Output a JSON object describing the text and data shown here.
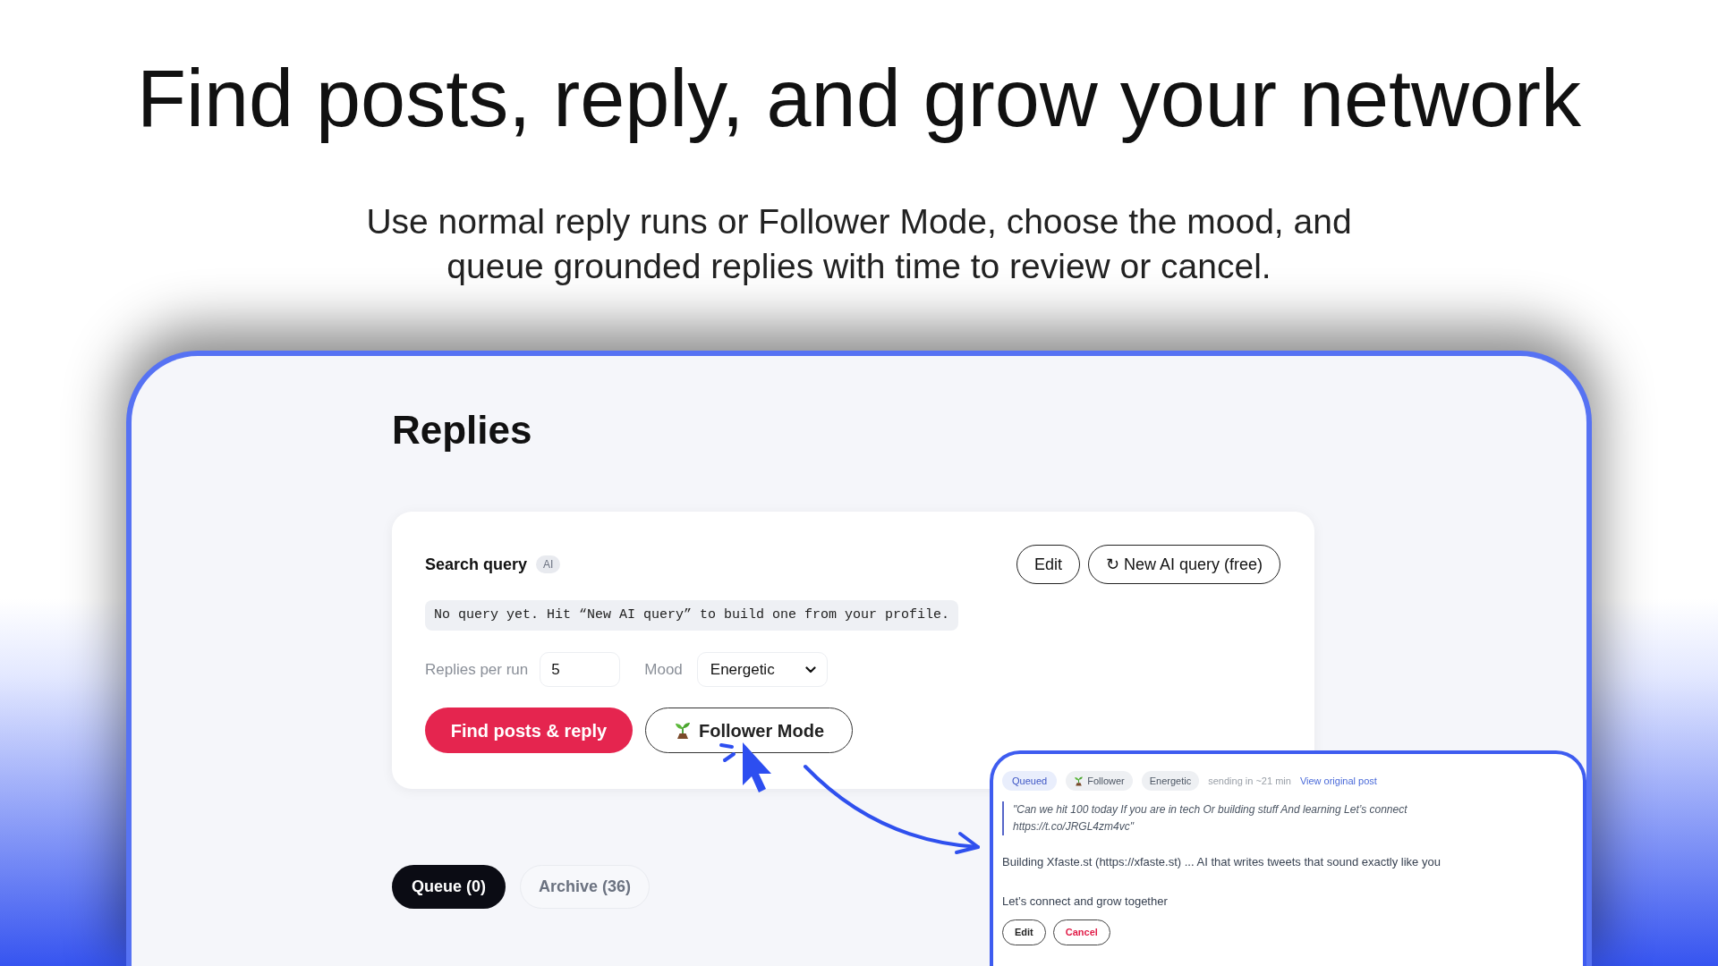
{
  "headline": "Find posts, reply, and grow your network",
  "subheadline": "Use normal reply runs or Follower Mode, choose the mood, and queue grounded replies with time to review or cancel.",
  "page": {
    "title": "Replies"
  },
  "search_card": {
    "label": "Search query",
    "tag": "AI",
    "buttons": [
      {
        "label": "Edit"
      },
      {
        "label": "↻ New AI query (free)"
      }
    ],
    "query_text": "No query yet. Hit “New AI query” to build one from your profile.",
    "replies_per_run": {
      "label": "Replies per run",
      "value": "5"
    },
    "mood": {
      "label": "Mood",
      "value": "Energetic"
    },
    "actions": [
      {
        "label": "Find posts & reply",
        "kind": "primary"
      },
      {
        "label": "Follower Mode",
        "kind": "mode"
      }
    ]
  },
  "tabs": [
    {
      "label": "Queue (0)",
      "selected": true
    },
    {
      "label": "Archive (36)",
      "selected": false
    }
  ],
  "queued_reply": {
    "tags": [
      {
        "label": "Queued",
        "kind": "status"
      },
      {
        "label": "Follower",
        "kind": "mode"
      },
      {
        "label": "Energetic",
        "kind": "mood"
      }
    ],
    "timing": "sending in ~21 min",
    "link": "View original post",
    "quote": "\"Can we hit 100 today If you are in tech Or building stuff And learning Let’s connect https://t.co/JRGL4zm4vc\"",
    "paragraphs": [
      "Building Xfaste.st (https://xfaste.st) ... AI that writes tweets that sound exactly like you",
      "Let’s connect and grow together"
    ],
    "buttons": [
      {
        "label": "Edit",
        "kind": "neutral"
      },
      {
        "label": "Cancel",
        "kind": "danger"
      }
    ]
  }
}
